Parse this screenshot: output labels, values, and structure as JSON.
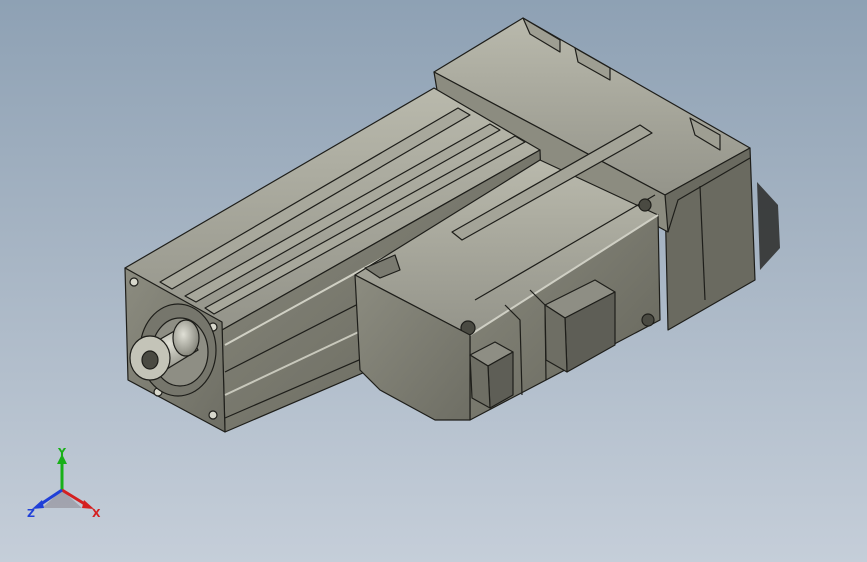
{
  "viewport": {
    "background_top": "#8ea1b4",
    "background_bottom": "#c5ced9"
  },
  "model": {
    "body_color": "#7d7d6f",
    "edge_color": "#1e1e1a"
  },
  "triad": {
    "x_label": "X",
    "y_label": "Y",
    "z_label": "Z",
    "x_color": "#d42020",
    "y_color": "#18b018",
    "z_color": "#2040d8"
  }
}
